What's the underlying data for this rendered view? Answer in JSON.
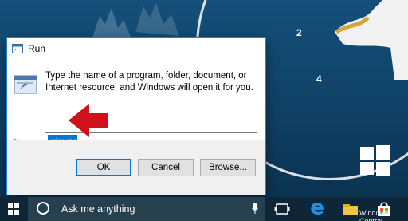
{
  "dialog": {
    "title": "Run",
    "description": "Type the name of a program, folder, document, or Internet resource, and Windows will open it for you.",
    "open_label": "Open:",
    "open_value": "winver",
    "ok_label": "OK",
    "cancel_label": "Cancel",
    "browse_label": "Browse..."
  },
  "taskbar": {
    "search_placeholder": "Ask me anything"
  },
  "wallpaper": {
    "clock_numbers": [
      "2",
      "4"
    ]
  },
  "watermark": "Windows Central",
  "colors": {
    "accent": "#0078d7",
    "arrow": "#d0111b",
    "taskbar": "#0f2538"
  },
  "icons": [
    "run-icon",
    "run-program-icon",
    "dropdown-arrow-icon",
    "red-arrow-icon",
    "start-icon",
    "cortana-icon",
    "microphone-icon",
    "task-view-icon",
    "edge-icon",
    "file-explorer-icon",
    "store-icon",
    "windows-logo-icon"
  ]
}
